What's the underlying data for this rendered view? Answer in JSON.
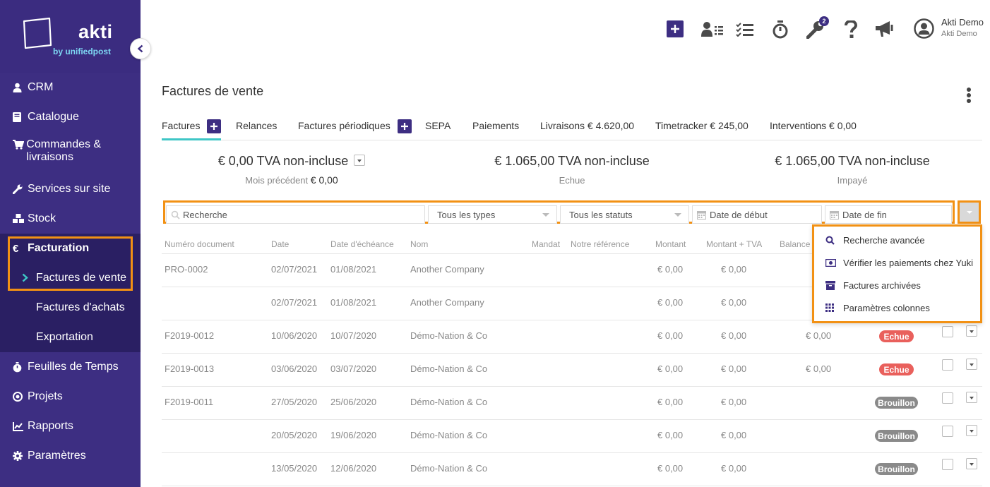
{
  "brand": {
    "name": "akti",
    "subtitle": "by unifiedpost"
  },
  "sidebar": {
    "items": [
      {
        "label": "CRM",
        "icon": "user-icon"
      },
      {
        "label": "Catalogue",
        "icon": "book-icon"
      },
      {
        "label": "Commandes & livraisons",
        "icon": "cart-icon"
      },
      {
        "label": "Services sur site",
        "icon": "wrench-icon"
      },
      {
        "label": "Stock",
        "icon": "boxes-icon"
      }
    ],
    "active_group": {
      "label": "Facturation",
      "icon": "euro-icon",
      "children": [
        {
          "label": "Factures de vente"
        },
        {
          "label": "Factures d'achats"
        },
        {
          "label": "Exportation"
        }
      ]
    },
    "items_after": [
      {
        "label": "Feuilles de Temps",
        "icon": "stopwatch-icon"
      },
      {
        "label": "Projets",
        "icon": "target-icon"
      },
      {
        "label": "Rapports",
        "icon": "chart-icon"
      },
      {
        "label": "Paramètres",
        "icon": "gear-icon"
      }
    ]
  },
  "topbar": {
    "notification_count": "2",
    "user_name": "Akti Demo",
    "user_company": "Akti Demo"
  },
  "page": {
    "title": "Factures de vente"
  },
  "tabs": [
    {
      "label": "Factures"
    },
    {
      "label": "Relances"
    },
    {
      "label": "Factures périodiques"
    },
    {
      "label": "SEPA"
    },
    {
      "label": "Paiements"
    },
    {
      "label": "Livraisons € 4.620,00"
    },
    {
      "label": "Timetracker € 245,00"
    },
    {
      "label": "Interventions € 0,00"
    }
  ],
  "summary": [
    {
      "amount": "€ 0,00 TVA non-incluse",
      "label": "Mois précédent",
      "extra": "€ 0,00"
    },
    {
      "amount": "€ 1.065,00 TVA non-incluse",
      "label": "Echue"
    },
    {
      "amount": "€ 1.065,00 TVA non-incluse",
      "label": "Impayé"
    }
  ],
  "filters": {
    "search_placeholder": "Recherche",
    "type": "Tous les types",
    "status": "Tous les statuts",
    "start_date": "Date de début",
    "end_date": "Date de fin"
  },
  "dropdown_menu": [
    {
      "label": "Recherche avancée",
      "icon": "search-icon"
    },
    {
      "label": "Vérifier les paiements chez Yuki",
      "icon": "money-icon"
    },
    {
      "label": "Factures archivées",
      "icon": "archive-icon"
    },
    {
      "label": "Paramètres colonnes",
      "icon": "grid-icon"
    }
  ],
  "table": {
    "headers": [
      "Numéro document",
      "Date",
      "Date d'échéance",
      "Nom",
      "Mandat",
      "Notre référence",
      "Montant",
      "Montant + TVA",
      "Balance"
    ],
    "rows": [
      {
        "number": "PRO-0002",
        "date": "02/07/2021",
        "due": "01/08/2021",
        "name": "Another Company",
        "amount": "€ 0,00",
        "amount_vat": "€ 0,00",
        "balance": "",
        "status": ""
      },
      {
        "number": "",
        "date": "02/07/2021",
        "due": "01/08/2021",
        "name": "Another Company",
        "amount": "€ 0,00",
        "amount_vat": "€ 0,00",
        "balance": "",
        "status": ""
      },
      {
        "number": "F2019-0012",
        "date": "10/06/2020",
        "due": "10/07/2020",
        "name": "Démo-Nation & Co",
        "amount": "€ 0,00",
        "amount_vat": "€ 0,00",
        "balance": "€ 0,00",
        "status": "Echue"
      },
      {
        "number": "F2019-0013",
        "date": "03/06/2020",
        "due": "03/07/2020",
        "name": "Démo-Nation & Co",
        "amount": "€ 0,00",
        "amount_vat": "€ 0,00",
        "balance": "€ 0,00",
        "status": "Echue"
      },
      {
        "number": "F2019-0011",
        "date": "27/05/2020",
        "due": "25/06/2020",
        "name": "Démo-Nation & Co",
        "amount": "€ 0,00",
        "amount_vat": "€ 0,00",
        "balance": "",
        "status": "Brouillon"
      },
      {
        "number": "",
        "date": "20/05/2020",
        "due": "19/06/2020",
        "name": "Démo-Nation & Co",
        "amount": "€ 0,00",
        "amount_vat": "€ 0,00",
        "balance": "",
        "status": "Brouillon"
      },
      {
        "number": "",
        "date": "13/05/2020",
        "due": "12/06/2020",
        "name": "Démo-Nation & Co",
        "amount": "€ 0,00",
        "amount_vat": "€ 0,00",
        "balance": "",
        "status": "Brouillon"
      }
    ]
  },
  "colors": {
    "sidebar": "#3d2e82",
    "sidebar_active": "#2a1f63",
    "accent": "#3ec6c6",
    "highlight": "#f29114",
    "echue": "#e9605c",
    "brouillon": "#8a8a8a"
  }
}
